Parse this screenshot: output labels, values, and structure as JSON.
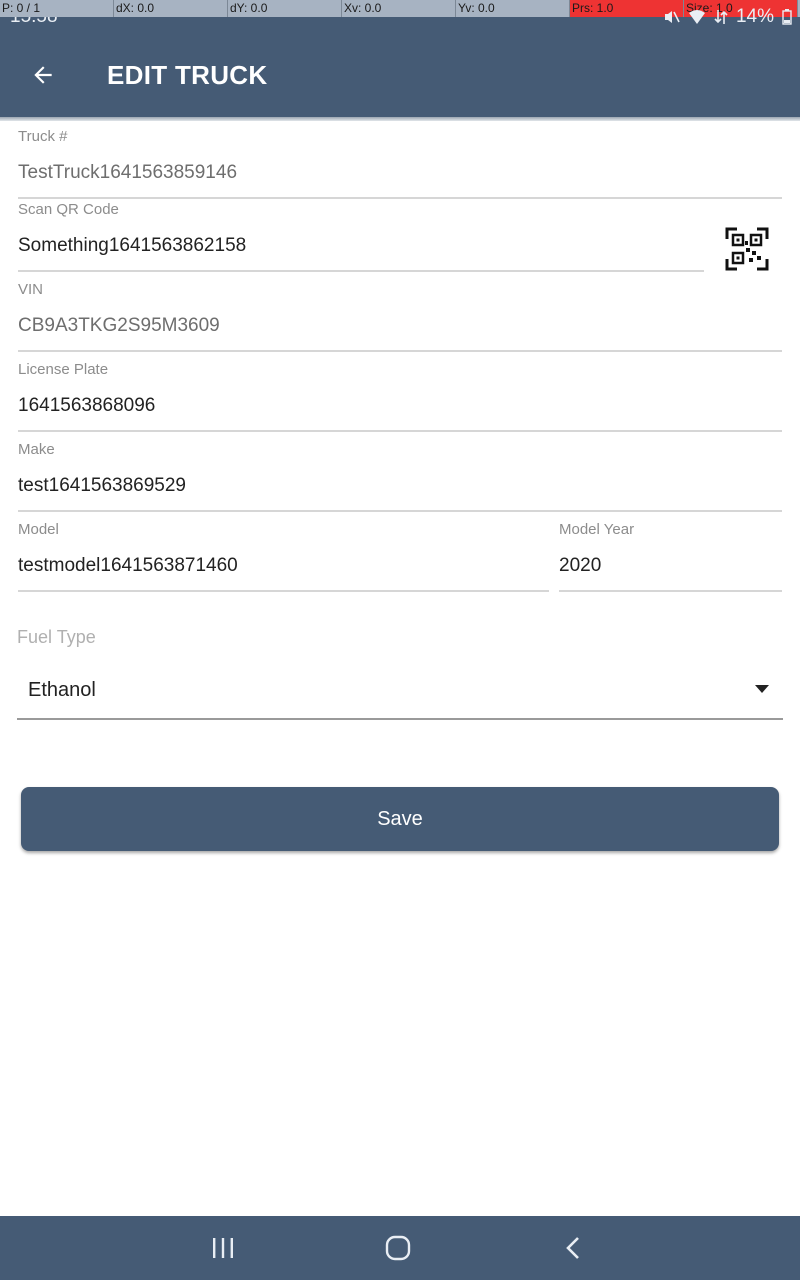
{
  "debug_bar": {
    "cells": [
      "P: 0 / 1",
      "dX: 0.0",
      "dY: 0.0",
      "Xv: 0.0",
      "Yv: 0.0",
      "Prs: 1.0",
      "Size: 1.0"
    ]
  },
  "status_bar": {
    "time": "15:58",
    "battery": "14%"
  },
  "header": {
    "title": "EDIT TRUCK",
    "back_icon": "arrow-left-icon",
    "color": "#455b75"
  },
  "form": {
    "truck_number": {
      "label": "Truck #",
      "value": "TestTruck1641563859146"
    },
    "qr_code": {
      "label": "Scan QR Code",
      "value": "Something1641563862158",
      "icon": "qr-code-icon"
    },
    "vin": {
      "label": "VIN",
      "value": "CB9A3TKG2S95M3609"
    },
    "license_plate": {
      "label": "License Plate",
      "value": "1641563868096"
    },
    "make": {
      "label": "Make",
      "value": "test1641563869529"
    },
    "model": {
      "label": "Model",
      "value": "testmodel1641563871460"
    },
    "model_year": {
      "label": "Model Year",
      "value": "2020"
    },
    "fuel_type": {
      "label": "Fuel Type",
      "value": "Ethanol",
      "icon": "caret-down-icon"
    }
  },
  "actions": {
    "save_label": "Save"
  },
  "nav_bar": {
    "recents_icon": "recents-icon",
    "home_icon": "home-icon",
    "back_icon": "chevron-left-icon"
  }
}
